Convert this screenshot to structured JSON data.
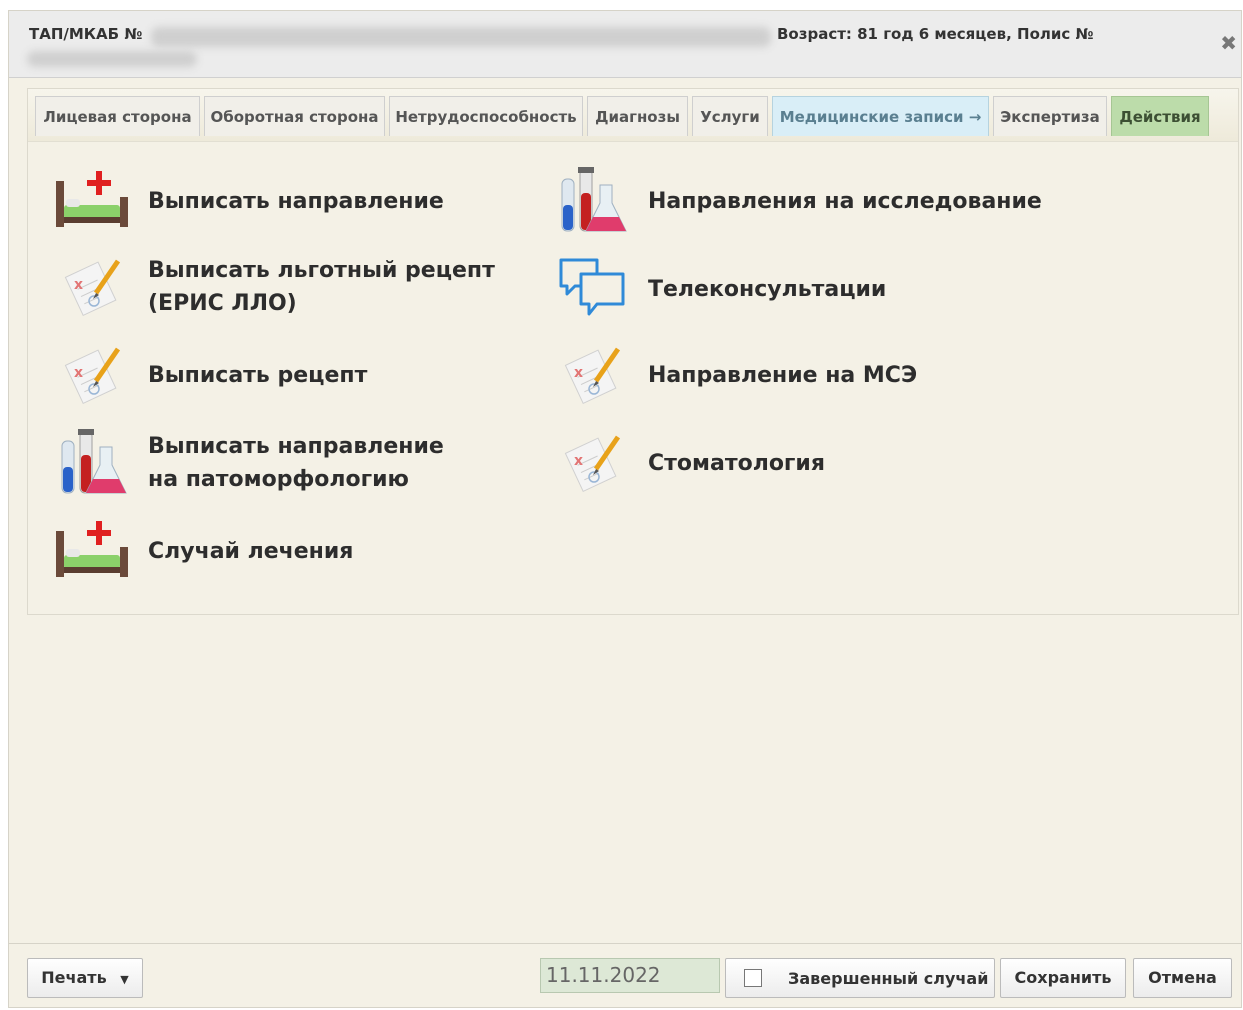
{
  "header": {
    "label": "ТАП/МКАБ №",
    "age_text": "Возраст: 81 год 6 месяцев, Полис №"
  },
  "tabs": [
    {
      "label": "Лицевая сторона",
      "state": "normal"
    },
    {
      "label": "Оборотная сторона",
      "state": "normal"
    },
    {
      "label": "Нетрудоспособность",
      "state": "normal"
    },
    {
      "label": "Диагнозы",
      "state": "normal"
    },
    {
      "label": "Услуги",
      "state": "normal"
    },
    {
      "label": "Медицинские записи →",
      "state": "highlight"
    },
    {
      "label": "Экспертиза",
      "state": "normal"
    },
    {
      "label": "Действия",
      "state": "active"
    }
  ],
  "actions_left": [
    {
      "label": "Выписать направление",
      "icon": "hospital-bed-icon"
    },
    {
      "label": "Выписать льготный рецепт\n(ЕРИС ЛЛО)",
      "icon": "prescription-icon"
    },
    {
      "label": "Выписать рецепт",
      "icon": "prescription-icon"
    },
    {
      "label": "Выписать направление\nна патоморфологию",
      "icon": "lab-flasks-icon"
    },
    {
      "label": "Случай лечения",
      "icon": "hospital-bed-icon"
    }
  ],
  "actions_right": [
    {
      "label": "Направления на исследование",
      "icon": "lab-flasks-icon"
    },
    {
      "label": "Телеконсультации",
      "icon": "chat-bubbles-icon"
    },
    {
      "label": "Направление на МСЭ",
      "icon": "prescription-icon"
    },
    {
      "label": "Стоматология",
      "icon": "prescription-icon"
    }
  ],
  "footer": {
    "print_label": "Печать",
    "date_value": "11.11.2022",
    "completed_label": "Завершенный случай",
    "completed_checked": false,
    "save_label": "Сохранить",
    "cancel_label": "Отмена"
  },
  "colors": {
    "background": "#f4f1e6",
    "active_tab": "#bcdcaa",
    "highlight_tab": "#d9eef7"
  }
}
